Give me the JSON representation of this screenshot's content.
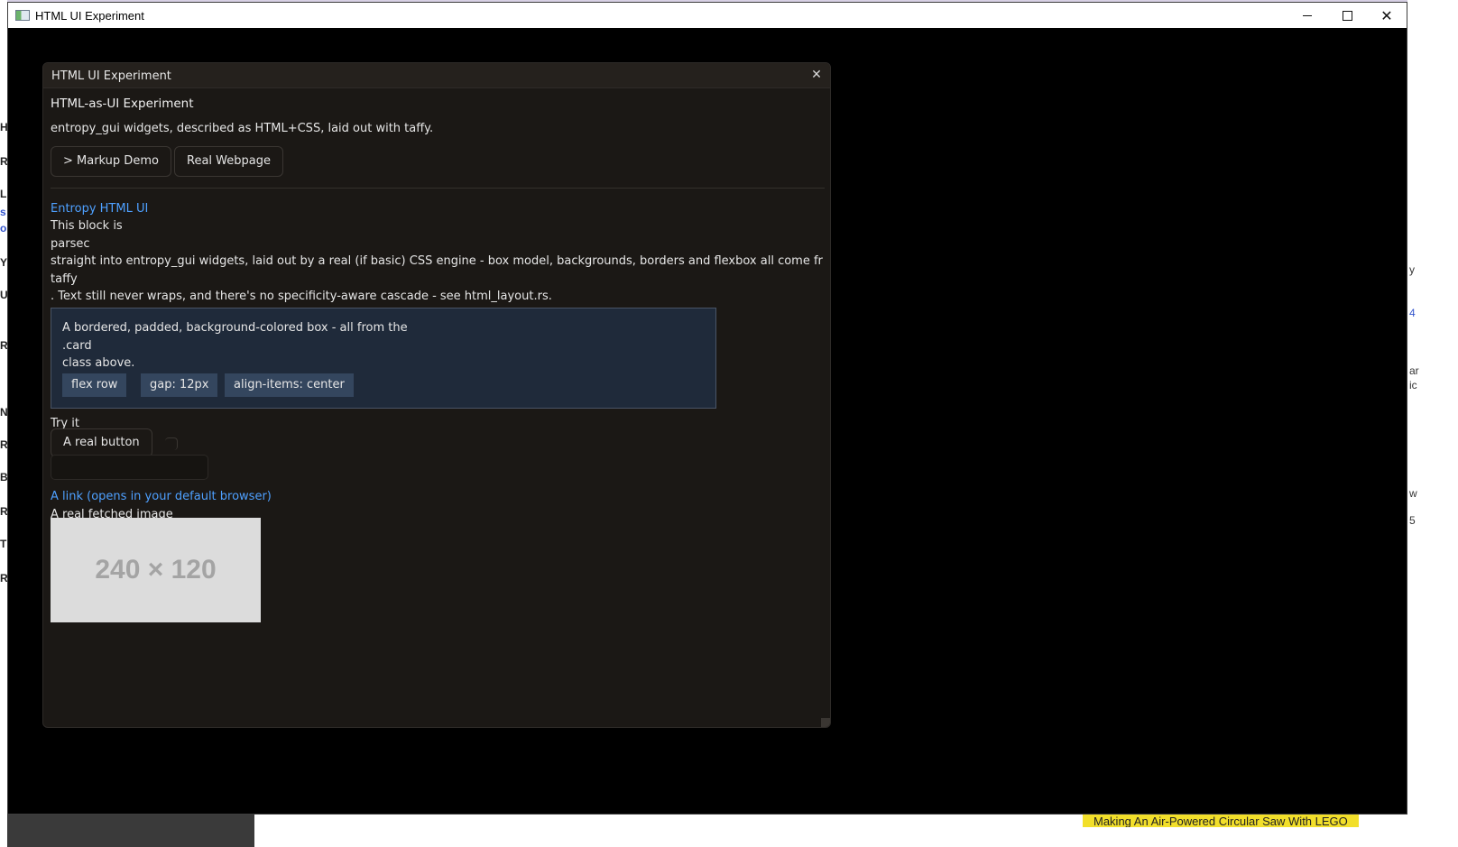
{
  "os_window": {
    "title": "HTML UI Experiment",
    "controls": {
      "minimize": "minimize",
      "maximize": "maximize",
      "close": "✕"
    }
  },
  "background": {
    "left_fragments": [
      "H",
      "R",
      "L",
      "s",
      "o",
      "Y",
      "U",
      "R",
      "N",
      "R",
      "B",
      "R",
      "T",
      "R"
    ],
    "right_fragments": [
      "y",
      "4",
      "ar",
      "ic",
      "w",
      "5"
    ],
    "bottom_video_title": "Making An Air-Powered Circular Saw With LEGO"
  },
  "egui_window": {
    "title": "HTML UI Experiment",
    "close_glyph": "✕",
    "heading": "HTML-as-UI Experiment",
    "description": "entropy_gui widgets, described as HTML+CSS, laid out with taffy.",
    "tabs": {
      "markup_demo": "> Markup Demo",
      "real_webpage": "Real Webpage"
    },
    "content": {
      "link_heading": "Entropy HTML UI",
      "line1": "This block is",
      "line2": "parsec",
      "line3": "straight into entropy_gui widgets, laid out by a real (if basic) CSS engine - box model, backgrounds, borders and flexbox all come fr",
      "line4": "taffy",
      "line5": ". Text still never wraps, and there's no specificity-aware cascade - see html_layout.rs.",
      "card": {
        "line1": "A bordered, padded, background-colored box - all from the",
        "line2": ".card",
        "line3": "class above.",
        "chips": [
          "flex row",
          "gap: 12px",
          "align-items: center"
        ]
      },
      "try_it": "Try it",
      "real_button": "A real button",
      "link": "A link (opens in your default browser)",
      "image_caption": "A real fetched image",
      "image_placeholder": "240 × 120"
    }
  }
}
